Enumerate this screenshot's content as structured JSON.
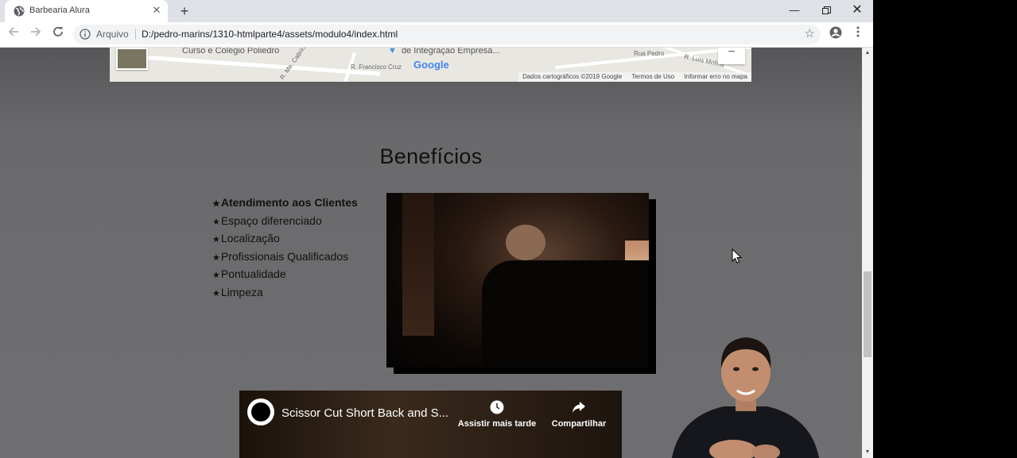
{
  "browser": {
    "tab_title": "Barbearia Alura",
    "scheme_label": "Arquivo",
    "url": "D:/pedro-marins/1310-htmlparte4/assets/modulo4/index.html"
  },
  "map": {
    "labels": [
      "Curso e Colégio Poliedro",
      "de Integração Empresa...",
      "R. Francisco Cruz",
      "Rua Pedro",
      "R. Luís Molina",
      "R. Me. Cabrini"
    ],
    "logo": "Google",
    "footer": [
      "Dados cartográficos ©2019 Google",
      "Termos de Uso",
      "Informar erro no mapa"
    ],
    "zoom_out": "−"
  },
  "beneficios": {
    "title": "Benefícios",
    "items": [
      "Atendimento aos Clientes",
      "Espaço diferenciado",
      "Localização",
      "Profissionais Qualificados",
      "Pontualidade",
      "Limpeza"
    ]
  },
  "video": {
    "title": "Scissor Cut Short Back and S...",
    "watch_later": "Assistir mais tarde",
    "share": "Compartilhar"
  },
  "icons": {
    "star": "★"
  }
}
